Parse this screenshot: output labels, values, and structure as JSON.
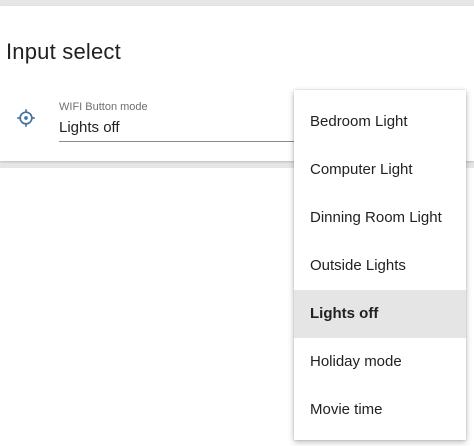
{
  "card": {
    "title": "Input select"
  },
  "field": {
    "icon": "crosshair-icon",
    "label": "WIFI Button mode",
    "value": "Lights off"
  },
  "dropdown": {
    "options": [
      "Bedroom Light",
      "Computer Light",
      "Dinning Room Light",
      "Outside Lights",
      "Lights off",
      "Holiday mode",
      "Movie time"
    ],
    "selected": "Lights off"
  },
  "colors": {
    "background": "#e6e6e6",
    "card": "#ffffff",
    "accent": "#44739e",
    "selected_item": "#e5e5e5"
  }
}
